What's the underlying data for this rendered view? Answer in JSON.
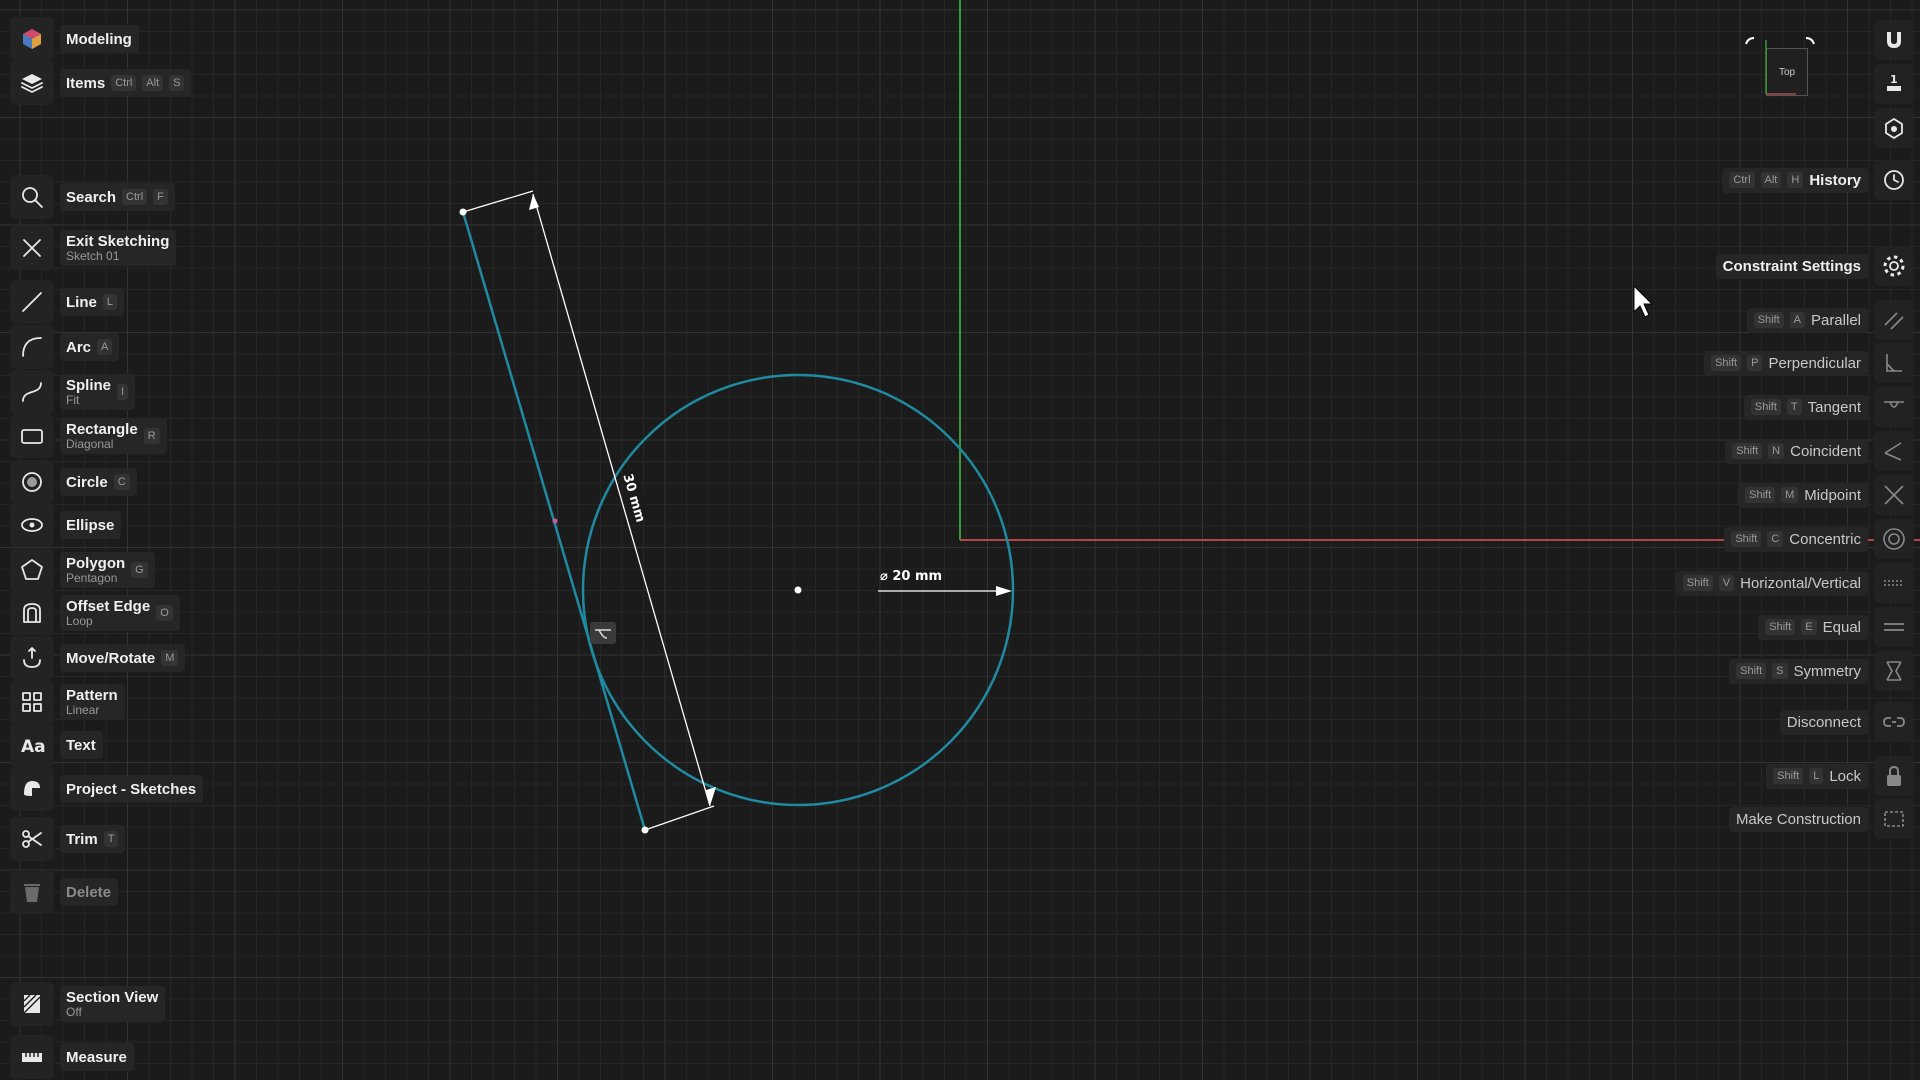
{
  "left_tools": [
    {
      "name": "mode-button",
      "label": "Modeling",
      "sub": "",
      "keys": [],
      "icon": "cube-icon"
    },
    {
      "name": "items-button",
      "label": "Items",
      "sub": "",
      "keys": [
        "Ctrl",
        "Alt",
        "S"
      ],
      "icon": "layers-icon"
    },
    {
      "name": "search-button",
      "label": "Search",
      "sub": "",
      "keys": [
        "Ctrl",
        "F"
      ],
      "icon": "search-icon"
    },
    {
      "name": "exit-sketching-button",
      "label": "Exit Sketching",
      "sub": "Sketch 01",
      "keys": [],
      "icon": "close-icon"
    },
    {
      "name": "line-tool",
      "label": "Line",
      "sub": "",
      "keys": [
        "L"
      ],
      "icon": "line-icon"
    },
    {
      "name": "arc-tool",
      "label": "Arc",
      "sub": "",
      "keys": [
        "A"
      ],
      "icon": "arc-icon"
    },
    {
      "name": "spline-tool",
      "label": "Spline",
      "sub": "Fit",
      "keys": [
        "I"
      ],
      "icon": "spline-icon"
    },
    {
      "name": "rectangle-tool",
      "label": "Rectangle",
      "sub": "Diagonal",
      "keys": [
        "R"
      ],
      "icon": "rectangle-icon"
    },
    {
      "name": "circle-tool",
      "label": "Circle",
      "sub": "",
      "keys": [
        "C"
      ],
      "icon": "circle-icon"
    },
    {
      "name": "ellipse-tool",
      "label": "Ellipse",
      "sub": "",
      "keys": [],
      "icon": "ellipse-icon"
    },
    {
      "name": "polygon-tool",
      "label": "Polygon",
      "sub": "Pentagon",
      "keys": [
        "G"
      ],
      "icon": "pentagon-icon"
    },
    {
      "name": "offset-edge-tool",
      "label": "Offset Edge",
      "sub": "Loop",
      "keys": [
        "O"
      ],
      "icon": "offset-icon"
    },
    {
      "name": "move-rotate-tool",
      "label": "Move/Rotate",
      "sub": "",
      "keys": [
        "M"
      ],
      "icon": "move-icon"
    },
    {
      "name": "pattern-tool",
      "label": "Pattern",
      "sub": "Linear",
      "keys": [],
      "icon": "grid-pattern-icon"
    },
    {
      "name": "text-tool",
      "label": "Text",
      "sub": "",
      "keys": [],
      "icon": "text-icon"
    },
    {
      "name": "project-sketches-tool",
      "label": "Project - Sketches",
      "sub": "",
      "keys": [],
      "icon": "project-icon"
    },
    {
      "name": "trim-tool",
      "label": "Trim",
      "sub": "",
      "keys": [
        "T"
      ],
      "icon": "scissors-icon"
    },
    {
      "name": "delete-button",
      "label": "Delete",
      "sub": "",
      "keys": [],
      "icon": "trash-icon"
    },
    {
      "name": "section-view-button",
      "label": "Section View",
      "sub": "Off",
      "keys": [],
      "icon": "section-icon"
    },
    {
      "name": "measure-button",
      "label": "Measure",
      "sub": "",
      "keys": [],
      "icon": "ruler-icon"
    }
  ],
  "right_tools": [
    {
      "name": "history-button",
      "label": "History",
      "keys": [
        "Ctrl",
        "Alt",
        "H"
      ],
      "icon": "clock-icon",
      "bold": true
    },
    {
      "name": "constraint-settings-button",
      "label": "Constraint Settings",
      "keys": [],
      "icon": "gear-icon",
      "bold": true
    },
    {
      "name": "parallel-constraint",
      "label": "Parallel",
      "keys": [
        "Shift",
        "A"
      ],
      "icon": "parallel-icon"
    },
    {
      "name": "perpendicular-constraint",
      "label": "Perpendicular",
      "keys": [
        "Shift",
        "P"
      ],
      "icon": "perpendicular-icon"
    },
    {
      "name": "tangent-constraint",
      "label": "Tangent",
      "keys": [
        "Shift",
        "T"
      ],
      "icon": "tangent-icon"
    },
    {
      "name": "coincident-constraint",
      "label": "Coincident",
      "keys": [
        "Shift",
        "N"
      ],
      "icon": "coincident-icon"
    },
    {
      "name": "midpoint-constraint",
      "label": "Midpoint",
      "keys": [
        "Shift",
        "M"
      ],
      "icon": "midpoint-icon"
    },
    {
      "name": "concentric-constraint",
      "label": "Concentric",
      "keys": [
        "Shift",
        "C"
      ],
      "icon": "concentric-icon"
    },
    {
      "name": "horizontal-vertical-constraint",
      "label": "Horizontal/Vertical",
      "keys": [
        "Shift",
        "V"
      ],
      "icon": "horizontal-vertical-icon"
    },
    {
      "name": "equal-constraint",
      "label": "Equal",
      "keys": [
        "Shift",
        "E"
      ],
      "icon": "equal-icon"
    },
    {
      "name": "symmetry-constraint",
      "label": "Symmetry",
      "keys": [
        "Shift",
        "S"
      ],
      "icon": "symmetry-icon"
    },
    {
      "name": "disconnect-button",
      "label": "Disconnect",
      "keys": [],
      "icon": "disconnect-icon"
    },
    {
      "name": "lock-constraint",
      "label": "Lock",
      "keys": [
        "Shift",
        "L"
      ],
      "icon": "lock-icon"
    },
    {
      "name": "make-construction-button",
      "label": "Make Construction",
      "keys": [],
      "icon": "construction-icon"
    }
  ],
  "top_right_icons": [
    "magnet-icon",
    "scale-icon",
    "snap-icon"
  ],
  "view_cube": {
    "label": "Top"
  },
  "sketch": {
    "diameter_label": "⌀ 20 mm",
    "length_label": "30 mm"
  },
  "colors": {
    "background": "#1b1b1b",
    "sketch_line": "#1f8aa0",
    "axis_green": "#3a9a3a",
    "axis_red": "#b04848"
  }
}
